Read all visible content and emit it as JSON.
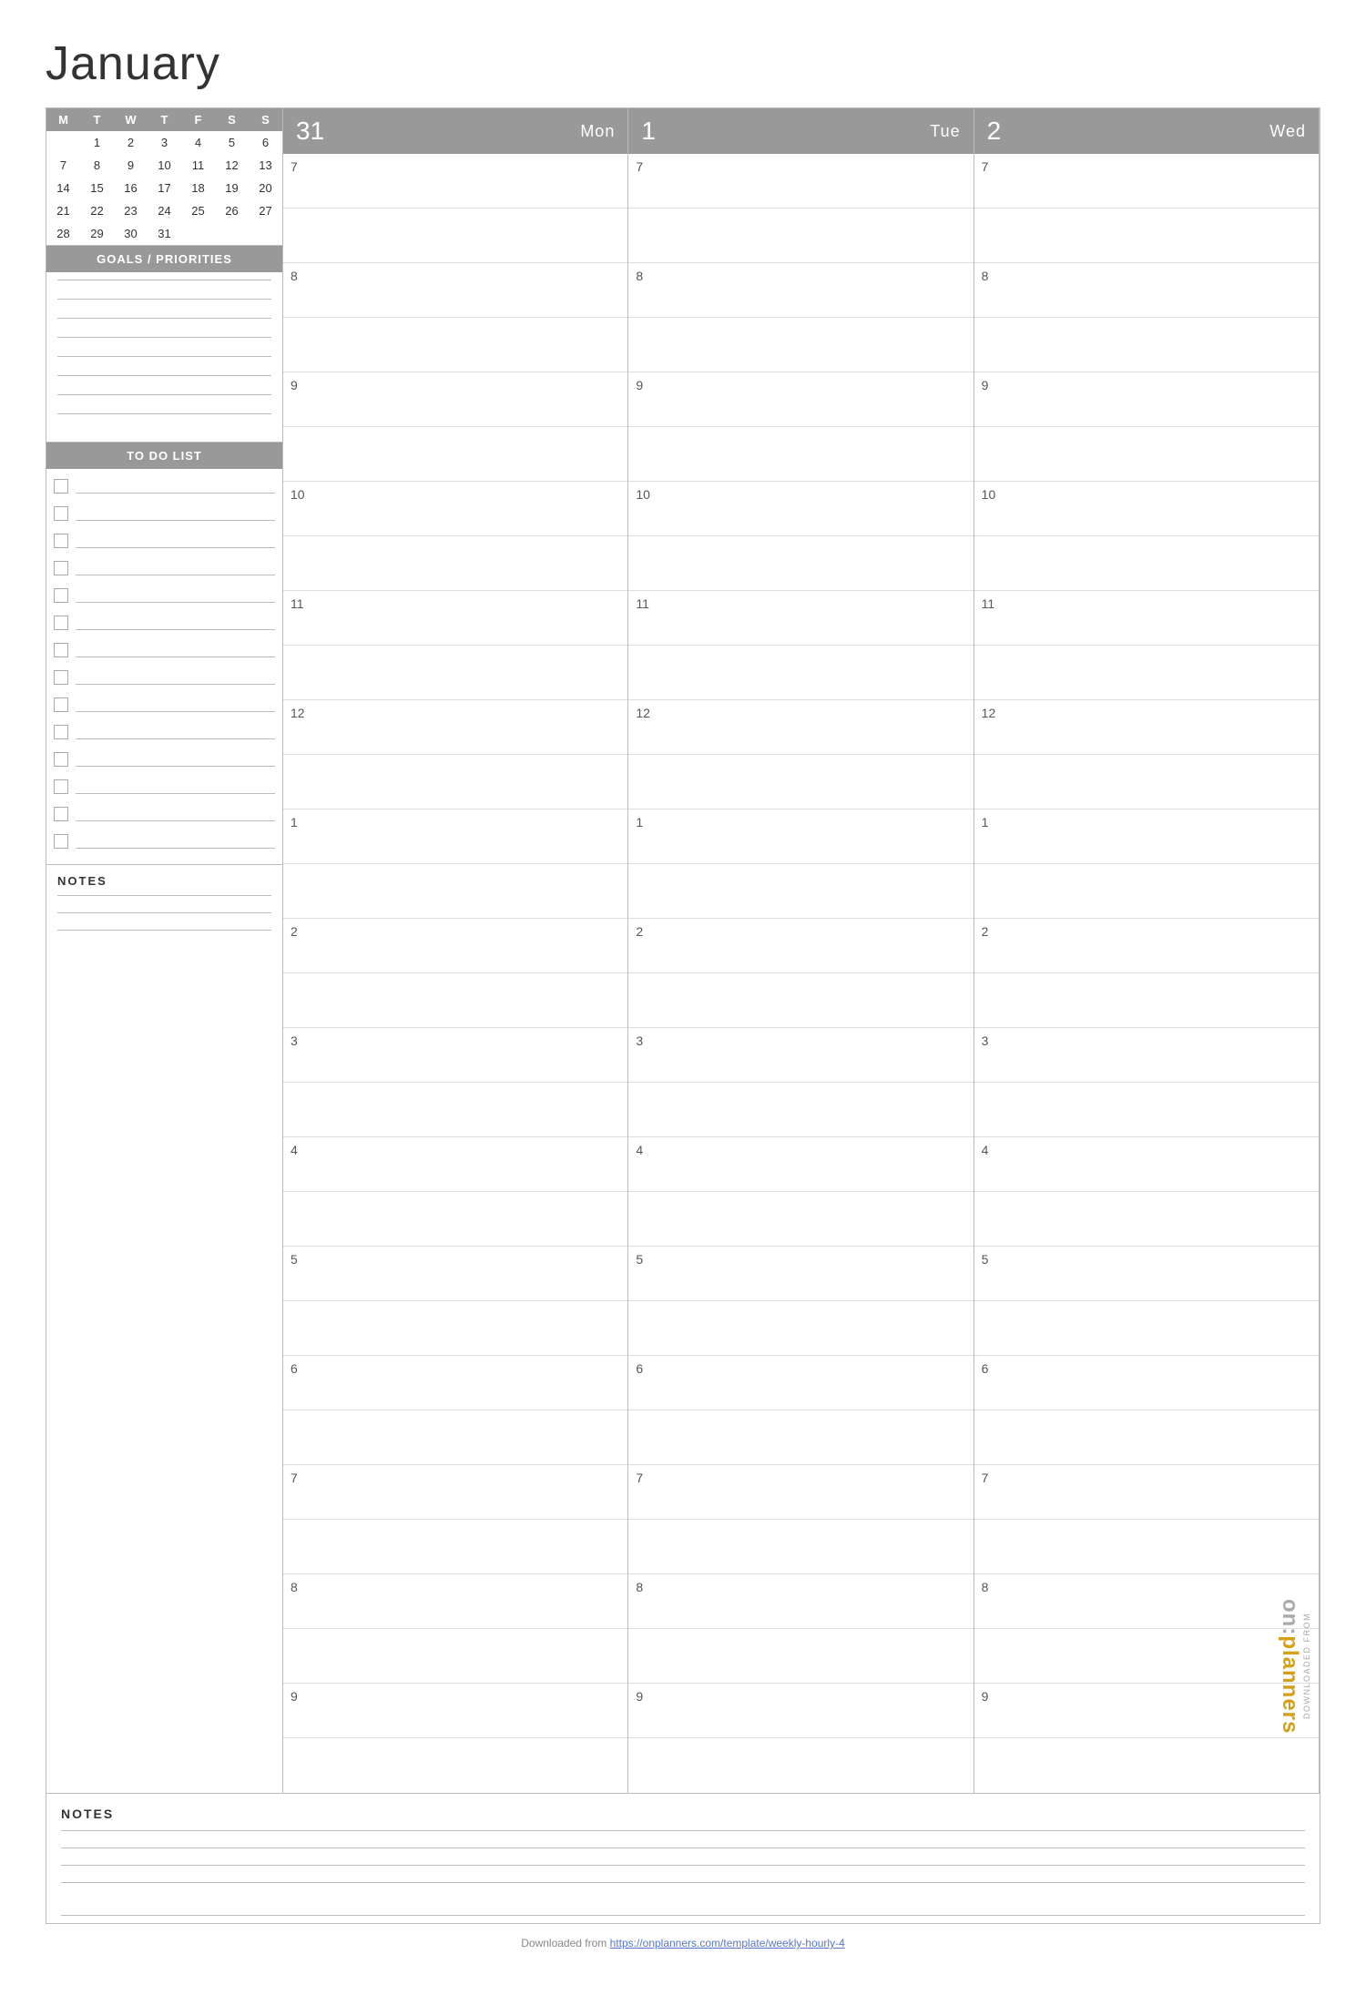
{
  "page": {
    "month": "January",
    "footer_url": "Downloaded from https://onplanners.com/template/weekly-hourly-4",
    "footer_link": "https://onplanners.com/template/weekly-hourly-4"
  },
  "mini_calendar": {
    "headers": [
      "M",
      "T",
      "W",
      "T",
      "F",
      "S",
      "S"
    ],
    "rows": [
      [
        "",
        "1",
        "2",
        "3",
        "4",
        "5",
        "6"
      ],
      [
        "7",
        "8",
        "9",
        "10",
        "11",
        "12",
        "13"
      ],
      [
        "14",
        "15",
        "16",
        "17",
        "18",
        "19",
        "20"
      ],
      [
        "21",
        "22",
        "23",
        "24",
        "25",
        "26",
        "27"
      ],
      [
        "28",
        "29",
        "30",
        "31",
        "",
        "",
        ""
      ]
    ]
  },
  "goals_section": {
    "label": "GOALS / PRIORITIES"
  },
  "todo_section": {
    "label": "TO DO LIST",
    "items_count": 14
  },
  "notes_section": {
    "label": "NOTES"
  },
  "days": [
    {
      "number": "31",
      "name": "Mon"
    },
    {
      "number": "1",
      "name": "Tue"
    },
    {
      "number": "2",
      "name": "Wed"
    }
  ],
  "hours": [
    {
      "label": "7"
    },
    {
      "label": ""
    },
    {
      "label": "8"
    },
    {
      "label": ""
    },
    {
      "label": "9"
    },
    {
      "label": ""
    },
    {
      "label": "10"
    },
    {
      "label": ""
    },
    {
      "label": "11"
    },
    {
      "label": ""
    },
    {
      "label": "12"
    },
    {
      "label": ""
    },
    {
      "label": "1"
    },
    {
      "label": ""
    },
    {
      "label": "2"
    },
    {
      "label": ""
    },
    {
      "label": "3"
    },
    {
      "label": ""
    },
    {
      "label": "4"
    },
    {
      "label": ""
    },
    {
      "label": "5"
    },
    {
      "label": ""
    },
    {
      "label": "6"
    },
    {
      "label": ""
    },
    {
      "label": "7"
    },
    {
      "label": ""
    },
    {
      "label": "8"
    },
    {
      "label": ""
    },
    {
      "label": "9"
    },
    {
      "label": ""
    }
  ],
  "hours_labeled": [
    "7",
    "8",
    "9",
    "10",
    "11",
    "12",
    "1",
    "2",
    "3",
    "4",
    "5",
    "6",
    "7",
    "8",
    "9"
  ],
  "branding": {
    "downloaded_from": "DOWNLOADED FROM",
    "brand": "on:planners"
  }
}
